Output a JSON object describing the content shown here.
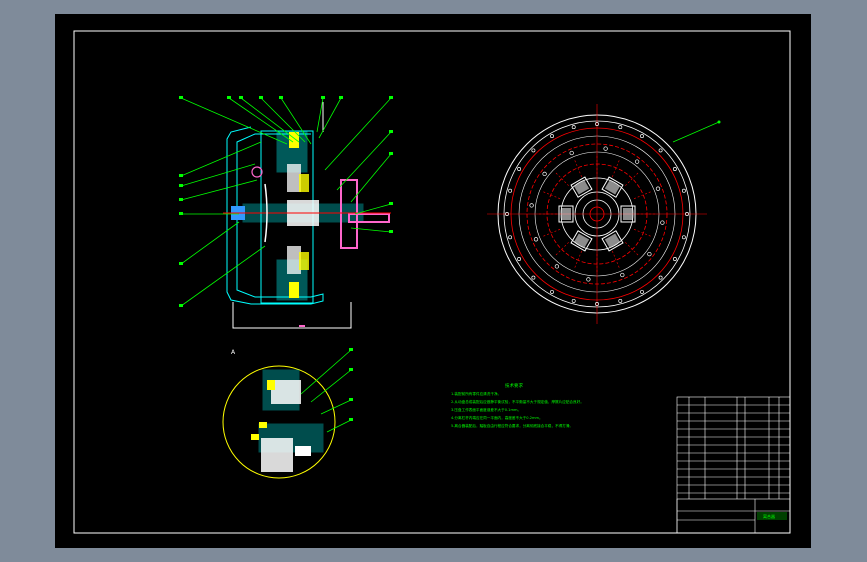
{
  "window": {
    "background_color": "#7f8b9a",
    "sheet_color": "#000000"
  },
  "colors": {
    "frame": "#ffffff",
    "leader": "#00ff00",
    "section_line": "#00ffff",
    "hatch": "#00ffff",
    "red_line": "#ff0000",
    "yellow_line": "#ffff00",
    "table_line": "#ffffff",
    "component": "#ff00ff"
  },
  "drawing": {
    "detail_label": "A",
    "notes_title": "技术要求",
    "notes": [
      "1.装配前所有零件应清洗干净。",
      "2.从动盘总成装配后应做静平衡试验，不平衡量不大于规定值，摩擦片应贴合良好。",
      "3.压盘工作表面平面度误差不大于0.1mm。",
      "4.分离杠杆内端应在同一平面内，高度差不大于0.2mm。",
      "5.离合器装配后，踏板自由行程应符合要求，分离彻底接合平稳，不得打滑。"
    ],
    "title_block": {
      "title_cell": "离合器"
    }
  }
}
